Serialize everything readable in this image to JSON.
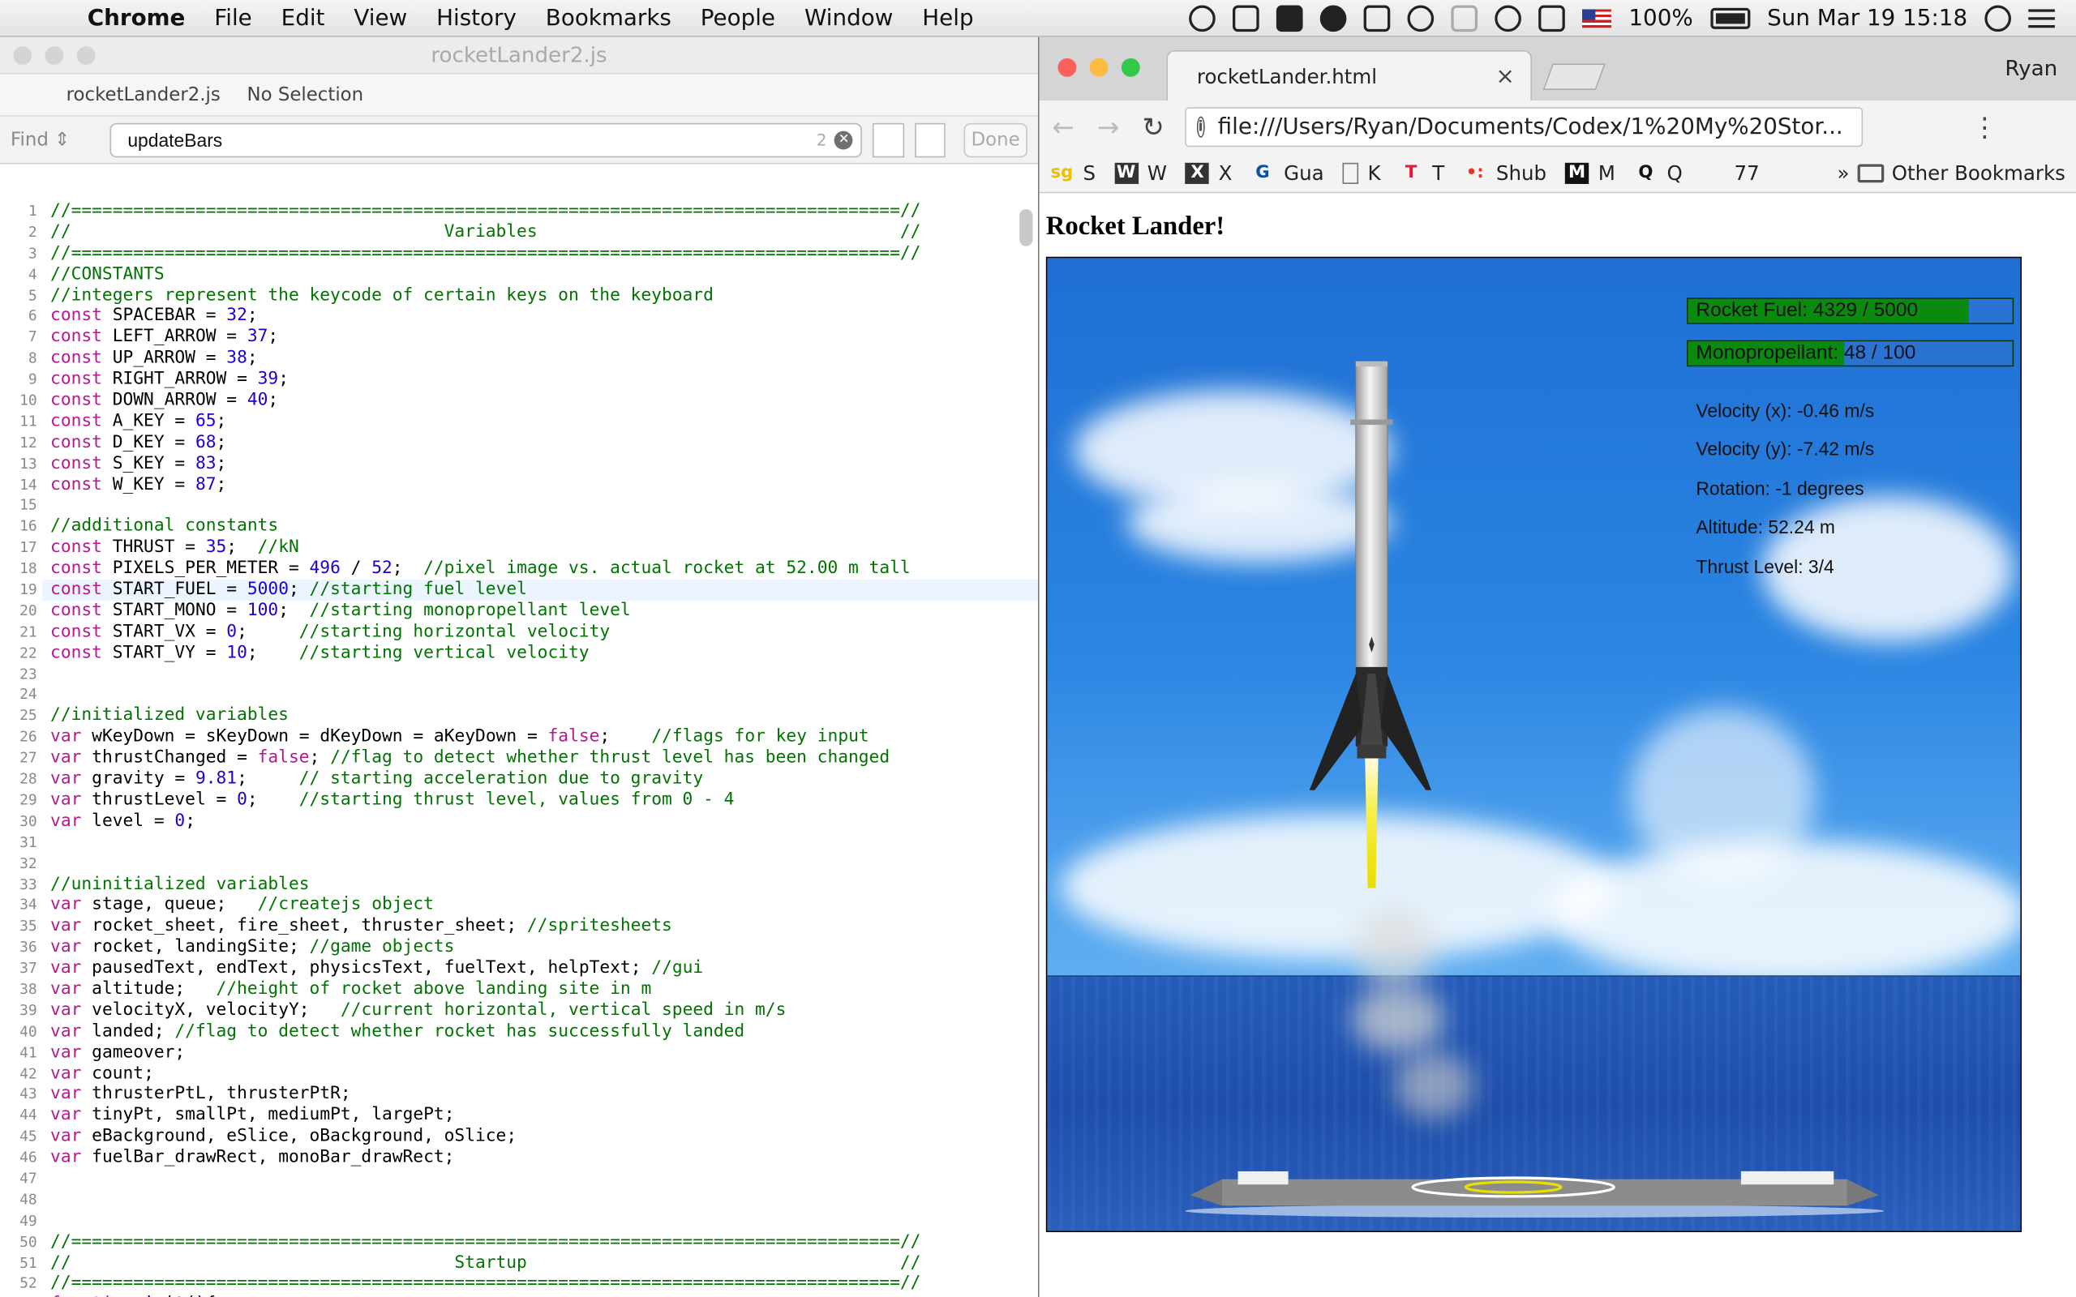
{
  "menubar": {
    "app": "Chrome",
    "items": [
      "File",
      "Edit",
      "View",
      "History",
      "Bookmarks",
      "People",
      "Window",
      "Help"
    ],
    "battery": "100%",
    "datetime": "Sun Mar 19  15:18"
  },
  "editor": {
    "window_title": "rocketLander2.js",
    "jump_bar": {
      "file": "rocketLander2.js",
      "selection": "No Selection"
    },
    "find": {
      "mode": "Find",
      "query": "updateBars",
      "match_count": "2",
      "done_label": "Done"
    },
    "current_line": 19,
    "lines": [
      "//================================================================================//",
      "//                                    Variables                                   //",
      "//================================================================================//",
      "//CONSTANTS",
      "//integers represent the keycode of certain keys on the keyboard",
      "const SPACEBAR = 32;",
      "const LEFT_ARROW = 37;",
      "const UP_ARROW = 38;",
      "const RIGHT_ARROW = 39;",
      "const DOWN_ARROW = 40;",
      "const A_KEY = 65;",
      "const D_KEY = 68;",
      "const S_KEY = 83;",
      "const W_KEY = 87;",
      "",
      "//additional constants",
      "const THRUST = 35;  //kN",
      "const PIXELS_PER_METER = 496 / 52;  //pixel image vs. actual rocket at 52.00 m tall",
      "const START_FUEL = 5000; //starting fuel level",
      "const START_MONO = 100;  //starting monopropellant level",
      "const START_VX = 0;     //starting horizontal velocity",
      "const START_VY = 10;    //starting vertical velocity",
      "",
      "",
      "//initialized variables",
      "var wKeyDown = sKeyDown = dKeyDown = aKeyDown = false;    //flags for key input",
      "var thrustChanged = false; //flag to detect whether thrust level has been changed",
      "var gravity = 9.81;     // starting acceleration due to gravity",
      "var thrustLevel = 0;    //starting thrust level, values from 0 - 4",
      "var level = 0;",
      "",
      "",
      "//uninitialized variables",
      "var stage, queue;   //createjs object",
      "var rocket_sheet, fire_sheet, thruster_sheet; //spritesheets",
      "var rocket, landingSite; //game objects",
      "var pausedText, endText, physicsText, fuelText, helpText; //gui",
      "var altitude;   //height of rocket above landing site in m",
      "var velocityX, velocityY;   //current horizontal, vertical speed in m/s",
      "var landed; //flag to detect whether rocket has successfully landed",
      "var gameover;",
      "var count;",
      "var thrusterPtL, thrusterPtR;",
      "var tinyPt, smallPt, mediumPt, largePt;",
      "var eBackground, eSlice, oBackground, oSlice;",
      "var fuelBar_drawRect, monoBar_drawRect;",
      "",
      "",
      "",
      "//================================================================================//",
      "//                                     Startup                                    //",
      "//================================================================================//",
      "function init(){"
    ]
  },
  "browser": {
    "tab_title": "rocketLander.html",
    "profile": "Ryan",
    "url": "file:///Users/Ryan/Documents/Codex/1%20My%20Stor...",
    "bookmarks": [
      {
        "icon": "sg",
        "label": "S"
      },
      {
        "icon": "W",
        "label": "W"
      },
      {
        "icon": "X",
        "label": "X"
      },
      {
        "icon": "G",
        "label": "Gua"
      },
      {
        "icon": "doc",
        "label": "K"
      },
      {
        "icon": "T",
        "label": "T"
      },
      {
        "icon": "dots",
        "label": "Shub"
      },
      {
        "icon": "M",
        "label": "M"
      },
      {
        "icon": "Q",
        "label": "Q"
      },
      {
        "icon": "77",
        "label": "77"
      }
    ],
    "overflow": "»",
    "other_bookmarks": "Other Bookmarks"
  },
  "game": {
    "heading": "Rocket Lander!",
    "fuel": {
      "label": "Rocket Fuel: 4329 / 5000",
      "value": 4329,
      "max": 5000,
      "fill_fraction": 0.8658
    },
    "mono": {
      "label": "Monopropellant: 48 / 100",
      "value": 48,
      "max": 100,
      "fill_fraction": 0.48
    },
    "stats": [
      "Velocity (x): -0.46 m/s",
      "Velocity (y): -7.42 m/s",
      "Rotation: -1 degrees",
      "Altitude: 52.24 m",
      "Thrust Level: 3/4"
    ]
  }
}
